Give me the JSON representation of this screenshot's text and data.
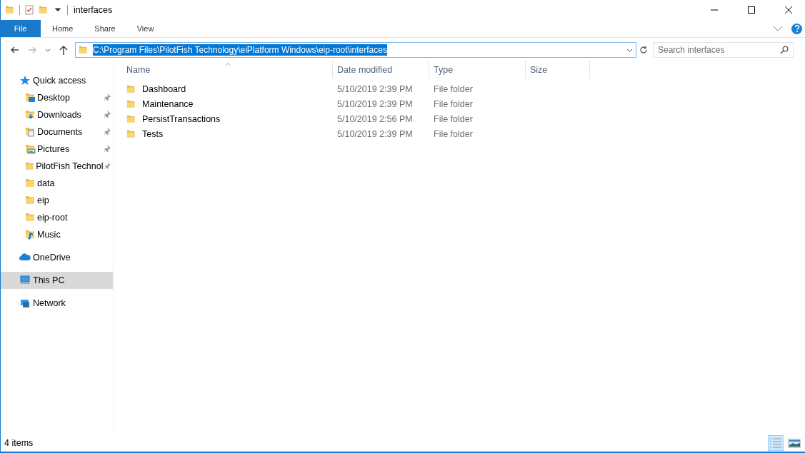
{
  "window": {
    "title": "interfaces"
  },
  "ribbon_tabs": [
    {
      "label": "File",
      "kind": "file"
    },
    {
      "label": "Home",
      "kind": "tab"
    },
    {
      "label": "Share",
      "kind": "tab"
    },
    {
      "label": "View",
      "kind": "tab"
    }
  ],
  "address": {
    "path": "C:\\Program Files\\PilotFish Technology\\eiPlatform Windows\\eip-root\\interfaces"
  },
  "search": {
    "placeholder": "Search interfaces"
  },
  "sidebar": {
    "items": [
      {
        "label": "Quick access",
        "kind": "star",
        "selected": false,
        "children": [
          {
            "label": "Desktop",
            "kind": "desktop",
            "pinned": true,
            "selected": false
          },
          {
            "label": "Downloads",
            "kind": "downloads",
            "pinned": true,
            "selected": false
          },
          {
            "label": "Documents",
            "kind": "documents",
            "pinned": true,
            "selected": false
          },
          {
            "label": "Pictures",
            "kind": "pictures",
            "pinned": true,
            "selected": false
          },
          {
            "label": "PilotFish Technol",
            "kind": "folder",
            "pinned": true,
            "selected": false
          },
          {
            "label": "data",
            "kind": "folder",
            "pinned": false,
            "selected": false
          },
          {
            "label": "eip",
            "kind": "folder",
            "pinned": false,
            "selected": false
          },
          {
            "label": "eip-root",
            "kind": "folder",
            "pinned": false,
            "selected": false
          },
          {
            "label": "Music",
            "kind": "music",
            "pinned": false,
            "selected": false
          }
        ]
      },
      {
        "label": "OneDrive",
        "kind": "cloud",
        "selected": false
      },
      {
        "label": "This PC",
        "kind": "pc",
        "selected": true
      },
      {
        "label": "Network",
        "kind": "network",
        "selected": false
      }
    ]
  },
  "table": {
    "columns": [
      "Name",
      "Date modified",
      "Type",
      "Size"
    ],
    "rows": [
      {
        "name": "Dashboard",
        "date": "5/10/2019 2:39 PM",
        "type": "File folder"
      },
      {
        "name": "Maintenance",
        "date": "5/10/2019 2:39 PM",
        "type": "File folder"
      },
      {
        "name": "PersistTransactions",
        "date": "5/10/2019 2:56 PM",
        "type": "File folder"
      },
      {
        "name": "Tests",
        "date": "5/10/2019 2:39 PM",
        "type": "File folder"
      }
    ]
  },
  "status_bar": {
    "text": "4 items",
    "views": [
      {
        "kind": "details",
        "selected": true
      },
      {
        "kind": "large-icons",
        "selected": false
      }
    ]
  }
}
